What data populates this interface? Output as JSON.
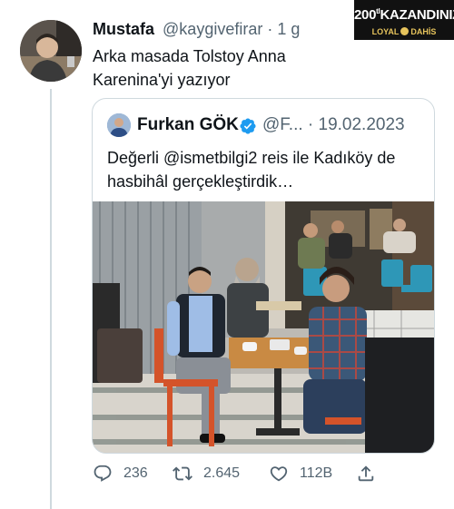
{
  "tweet": {
    "author_name": "Mustafa",
    "handle": "@kaygivefirar",
    "separator": "·",
    "time": "1 g",
    "text": "Arka masada Tolstoy Anna Karenina'yi yazıyor"
  },
  "promo": {
    "headline": "200",
    "headline_sup": "tl",
    "headline_tail": "KAZANDINIZ",
    "brand_left": "LOYAL",
    "brand_right": "DAHİS"
  },
  "quote": {
    "author_name": "Furkan GÖK",
    "handle": "@F...",
    "separator": "·",
    "date": "19.02.2023",
    "text": "Değerli @ismetbilgi2 reis ile Kadıköy de hasbihâl gerçekleştirdik…",
    "verified_icon": "verified-badge-icon",
    "accent_color": "#1d9bf0"
  },
  "actions": {
    "reply_count": "236",
    "retweet_count": "2.645",
    "like_count": "112B",
    "icons": [
      "reply-icon",
      "retweet-icon",
      "like-icon",
      "share-icon"
    ]
  }
}
